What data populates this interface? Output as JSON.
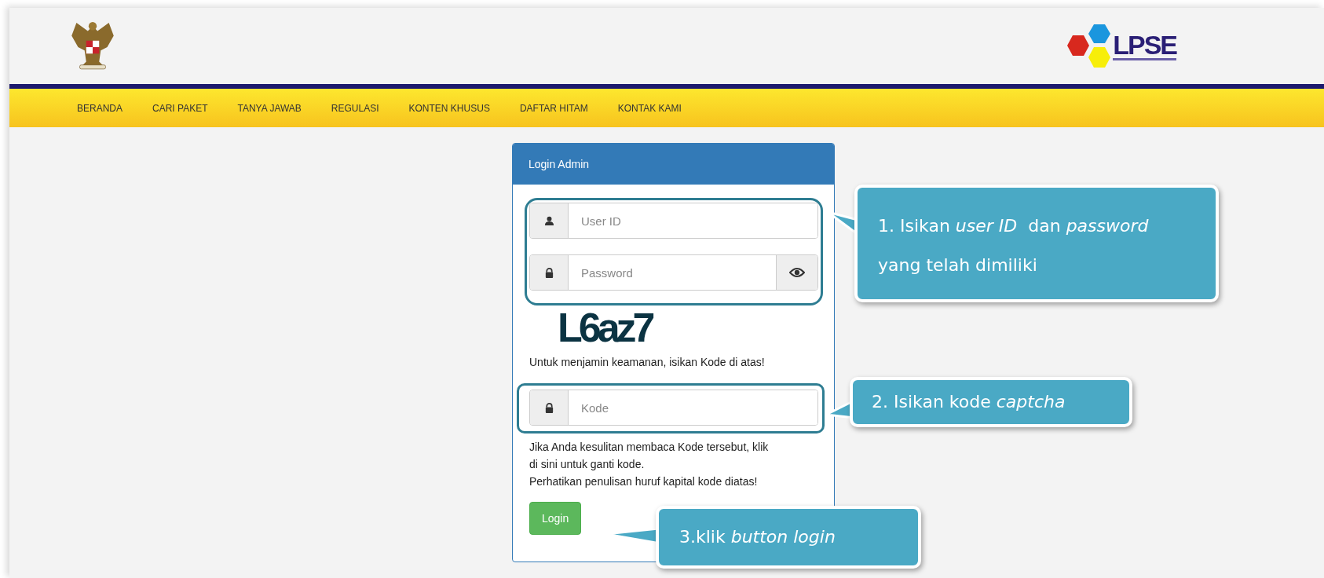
{
  "header": {
    "logo_text": "LPSE",
    "nav": [
      {
        "label": "BERANDA"
      },
      {
        "label": "CARI PAKET"
      },
      {
        "label": "TANYA JAWAB"
      },
      {
        "label": "REGULASI"
      },
      {
        "label": "KONTEN KHUSUS"
      },
      {
        "label": "DAFTAR HITAM"
      },
      {
        "label": "KONTAK KAMI"
      }
    ]
  },
  "login_panel": {
    "title": "Login Admin",
    "fields": [
      {
        "kind": "user",
        "placeholder": "User ID",
        "reveal_button": false
      },
      {
        "kind": "password",
        "placeholder": "Password",
        "reveal_button": true
      }
    ],
    "captcha": "L6az7",
    "captcha_hint": "Untuk menjamin keamanan, isikan Kode di atas!",
    "code_field": {
      "placeholder": "Kode"
    },
    "help_text": [
      "Jika Anda kesulitan membaca Kode tersebut, klik di sini untuk ganti kode.",
      "Perhatikan penulisan huruf kapital kode diatas!"
    ],
    "login_button": "Login"
  },
  "callouts": [
    {
      "text": "1. Isikan *user ID*  dan *password* yang telah dimiliki"
    },
    {
      "text": "2. Isikan kode *captcha*"
    },
    {
      "text": "3.klik *button login*"
    }
  ]
}
